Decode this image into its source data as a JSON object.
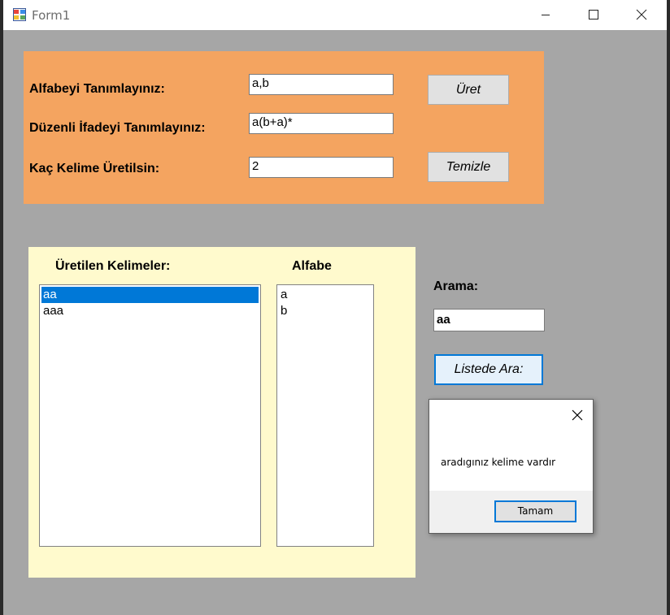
{
  "window": {
    "title": "Form1"
  },
  "form": {
    "alphabet_label": "Alfabeyi  Tanımlayınız:",
    "alphabet_value": "a,b",
    "regex_label": "Düzenli İfadeyi Tanımlayınız:",
    "regex_value": "a(b+a)*",
    "count_label": "Kaç Kelime Üretilsin:",
    "count_value": "2",
    "generate_button": "Üret",
    "clear_button": "Temizle"
  },
  "results": {
    "words_label": "Üretilen Kelimeler:",
    "words": [
      "aa",
      "aaa"
    ],
    "selected_index": 0,
    "alphabet_label": "Alfabe",
    "alphabet": [
      "a",
      "b"
    ]
  },
  "search": {
    "label": "Arama:",
    "value": "aa",
    "button": "Listede Ara:"
  },
  "messagebox": {
    "text": "aradıgınız kelime vardır",
    "ok_button": "Tamam"
  },
  "colors": {
    "top_panel": "#f4a460",
    "bottom_panel": "#fffacd",
    "form_background": "#a6a6a6",
    "selection": "#0078d7"
  }
}
